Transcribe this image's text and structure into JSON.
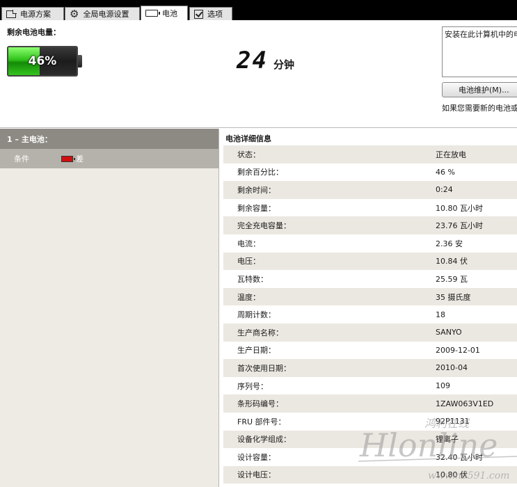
{
  "tabs": [
    {
      "label": "电源方案",
      "icon": "page-icon",
      "active": false
    },
    {
      "label": "全局电源设置",
      "icon": "gear-icon",
      "active": false
    },
    {
      "label": "电池",
      "icon": "battery-icon",
      "active": true
    },
    {
      "label": "选项",
      "icon": "checkbox-icon",
      "active": false
    }
  ],
  "top": {
    "remaining_label": "剩余电池电量：",
    "percent_text": "46%",
    "charge_fraction": 0.46,
    "time_value": "24",
    "time_unit": "分钟",
    "info_text": "安装在此计算机中的电",
    "maintenance_button": "电池维护(M)...",
    "replace_text": "如果您需要新的电池或"
  },
  "left": {
    "battery_header": "1 – 主电池：",
    "condition_label": "条件",
    "condition_value": "差"
  },
  "details": {
    "title": "电池详细信息",
    "rows": [
      {
        "key": "状态：",
        "value": "正在放电"
      },
      {
        "key": "剩余百分比：",
        "value": "46 %"
      },
      {
        "key": "剩余时间：",
        "value": "0:24"
      },
      {
        "key": "剩余容量：",
        "value": "10.80 瓦小时"
      },
      {
        "key": "完全充电容量：",
        "value": "23.76 瓦小时"
      },
      {
        "key": "电流：",
        "value": "2.36 安"
      },
      {
        "key": "电压：",
        "value": "10.84 伏"
      },
      {
        "key": "瓦特数：",
        "value": "25.59 瓦"
      },
      {
        "key": "温度：",
        "value": "35 摄氏度"
      },
      {
        "key": "周期计数：",
        "value": "18"
      },
      {
        "key": "生产商名称：",
        "value": "SANYO"
      },
      {
        "key": "生产日期：",
        "value": "2009-12-01"
      },
      {
        "key": "首次使用日期：",
        "value": "2010-04"
      },
      {
        "key": "序列号：",
        "value": "109"
      },
      {
        "key": "条形码编号：",
        "value": "1ZAW063V1ED"
      },
      {
        "key": "FRU 部件号：",
        "value": "92P1131"
      },
      {
        "key": "设备化学组成：",
        "value": "锂离子"
      },
      {
        "key": "设计容量：",
        "value": "32.40 瓦小时"
      },
      {
        "key": "设计电压：",
        "value": "10.80 伏"
      }
    ]
  },
  "watermark": {
    "script_text": "Hlonline",
    "cn_text": "鸿利在线",
    "url_text": "www.nb591.com"
  },
  "colors": {
    "battery_fill": "#2fc21a",
    "condition_bad": "#d01010",
    "left_header": "#8d8a84",
    "stripe": "#ebe8e1"
  }
}
